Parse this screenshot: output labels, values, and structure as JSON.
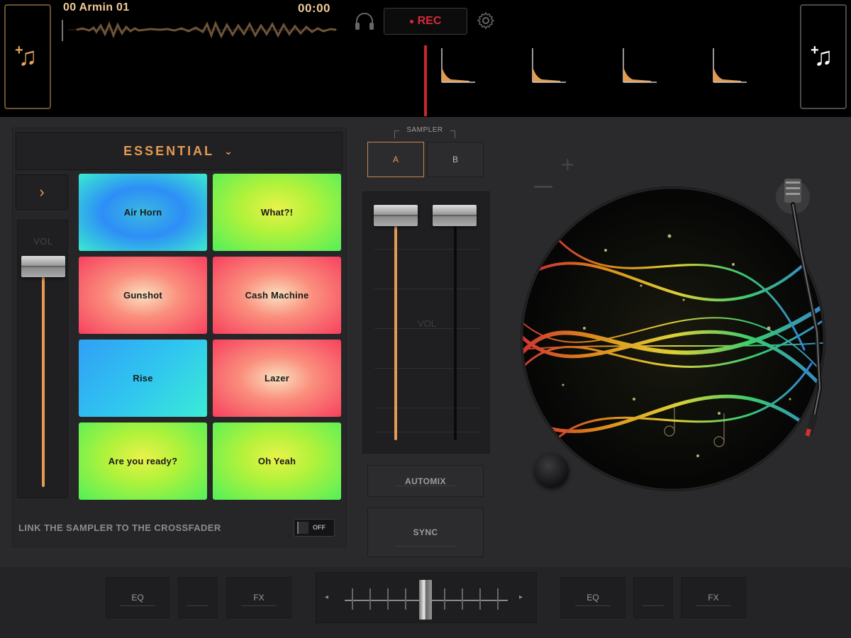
{
  "deck": {
    "track_title": "00 Armin 01",
    "time": "00:00",
    "rec_label": "REC",
    "add_track_left_icon": "music-note-plus-icon",
    "add_track_right_icon": "music-note-plus-icon"
  },
  "sampler": {
    "preset": "ESSENTIAL",
    "vol_label": "VOL",
    "pads": [
      {
        "label": "Air Horn",
        "color": "#2d8ef7"
      },
      {
        "label": "What?!",
        "color": "#b2f23b"
      },
      {
        "label": "Gunshot",
        "color": "#fa8f7d"
      },
      {
        "label": "Cash Machine",
        "color": "#fa8f7d"
      },
      {
        "label": "Rise",
        "color": "#31a0f5"
      },
      {
        "label": "Lazer",
        "color": "#fa8f7d"
      },
      {
        "label": "Are you ready?",
        "color": "#b2f23b"
      },
      {
        "label": "Oh Yeah",
        "color": "#b2f23b"
      }
    ],
    "link_label": "LINK THE SAMPLER TO THE CROSSFADER",
    "link_toggle": "OFF"
  },
  "mixer": {
    "caption": "SAMPLER",
    "tab_a": "A",
    "tab_b": "B",
    "vol_label": "VOL",
    "automix": "AUTOMIX",
    "sync": "SYNC"
  },
  "bottom": {
    "eq_left": "EQ",
    "fx_left": "FX",
    "eq_right": "EQ",
    "fx_right": "FX"
  },
  "colors": {
    "accent": "#e39a52",
    "rec": "#d9293a",
    "background": "#2a2a2c"
  }
}
